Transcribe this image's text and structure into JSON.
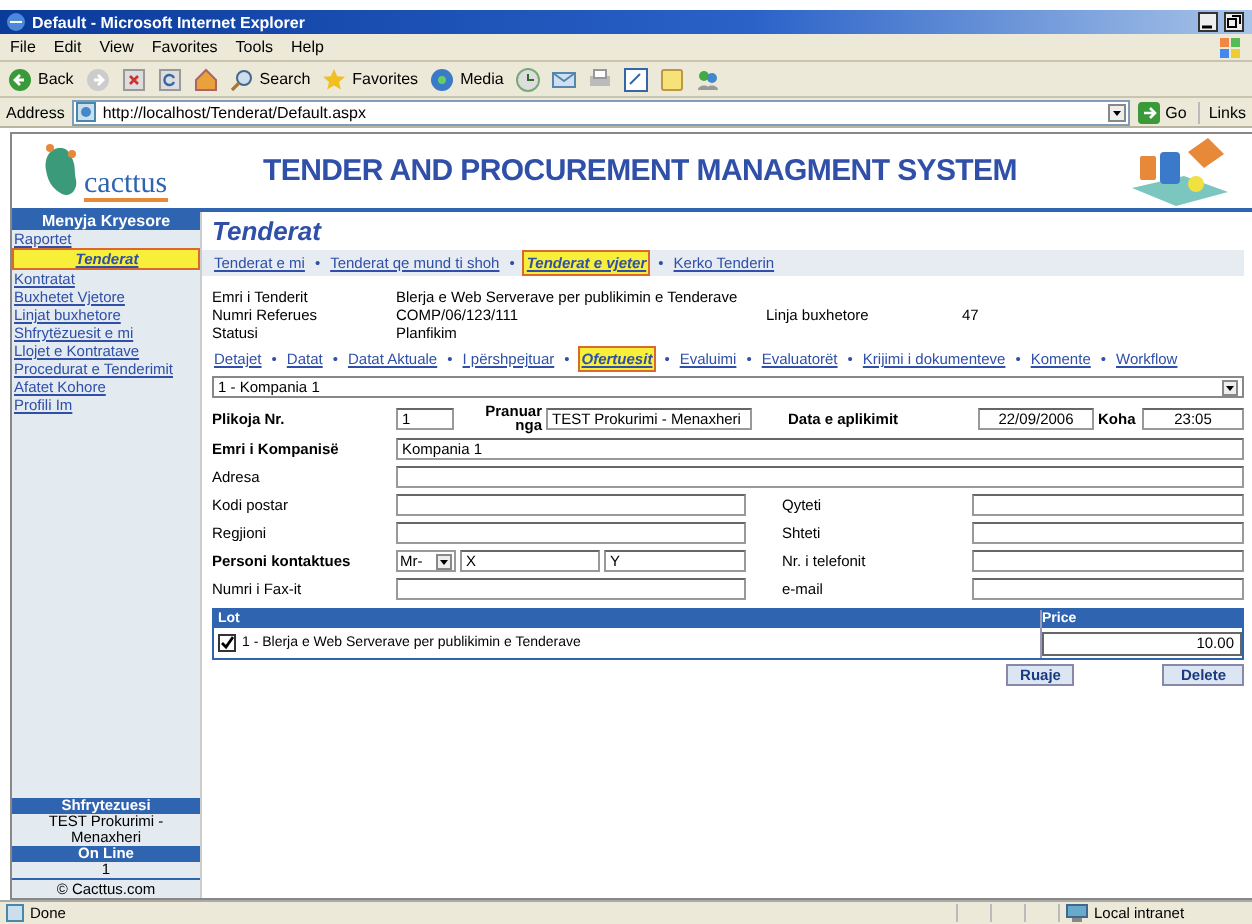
{
  "window": {
    "title": "Default - Microsoft Internet Explorer"
  },
  "menu": [
    "File",
    "Edit",
    "View",
    "Favorites",
    "Tools",
    "Help"
  ],
  "toolbar": [
    {
      "kind": "back",
      "label": "Back"
    },
    {
      "kind": "forward"
    },
    {
      "kind": "stop"
    },
    {
      "kind": "refresh"
    },
    {
      "kind": "home"
    },
    {
      "kind": "search",
      "label": "Search"
    },
    {
      "kind": "favorites",
      "label": "Favorites"
    },
    {
      "kind": "media",
      "label": "Media"
    },
    {
      "kind": "history"
    },
    {
      "kind": "mail"
    },
    {
      "kind": "print"
    },
    {
      "kind": "edit"
    },
    {
      "kind": "note"
    },
    {
      "kind": "messenger"
    }
  ],
  "address": {
    "label": "Address",
    "url": "http://localhost/Tenderat/Default.aspx",
    "go": "Go",
    "links": "Links"
  },
  "header": {
    "logo": "cacttus",
    "title": "TENDER AND PROCUREMENT MANAGMENT SYSTEM"
  },
  "sidebar": {
    "title": "Menyja Kryesore",
    "items": [
      {
        "label": "Raportet",
        "selected": false
      },
      {
        "label": "Tenderat",
        "selected": true
      },
      {
        "label": "Kontratat",
        "selected": false
      },
      {
        "label": "Buxhetet Vjetore",
        "selected": false
      },
      {
        "label": "Linjat buxhetore",
        "selected": false
      },
      {
        "label": "Shfrytëzuesit e mi",
        "selected": false
      },
      {
        "label": "Llojet e Kontratave",
        "selected": false
      },
      {
        "label": "Procedurat e Tenderimit",
        "selected": false
      },
      {
        "label": "Afatet Kohore",
        "selected": false
      },
      {
        "label": "Profili Im",
        "selected": false
      }
    ],
    "user_label": "Shfrytezuesi",
    "user_name": "TEST Prokurimi - Menaxheri",
    "online_label": "On Line",
    "online_count": "1",
    "copyright": "© Cacttus.com"
  },
  "main": {
    "title": "Tenderat",
    "separator": "•",
    "tabs": [
      {
        "label": "Tenderat e mi",
        "selected": false
      },
      {
        "label": "Tenderat qe mund ti shoh",
        "selected": false
      },
      {
        "label": "Tenderat e vjeter",
        "selected": true
      },
      {
        "label": "Kerko Tenderin",
        "selected": false
      }
    ],
    "info": [
      {
        "label": "Emri i Tenderit",
        "value": "Blerja e Web Serverave per publikimin e Tenderave"
      },
      {
        "label": "Numri Referues",
        "value": "COMP/06/123/111",
        "label_2": "Linja buxhetore",
        "value_2": "47"
      },
      {
        "label": "Statusi",
        "value": "Planfikim"
      }
    ],
    "subtabs": [
      {
        "label": "Detajet",
        "selected": false
      },
      {
        "label": "Datat",
        "selected": false
      },
      {
        "label": "Datat Aktuale",
        "selected": false
      },
      {
        "label": "I përshpejtuar",
        "selected": false
      },
      {
        "label": "Ofertuesit",
        "selected": true
      },
      {
        "label": "Evaluimi",
        "selected": false
      },
      {
        "label": "Evaluatorët",
        "selected": false
      },
      {
        "label": "Krijimi i dokumenteve",
        "selected": false
      },
      {
        "label": "Komente",
        "selected": false
      },
      {
        "label": "Workflow",
        "selected": false
      }
    ],
    "company_select": "1 - Kompania 1",
    "rows": [
      {
        "kind": "first",
        "cells": [
          {
            "kind": "label",
            "text": "Plikoja Nr.",
            "bold": true
          },
          {
            "kind": "input",
            "value": "1"
          },
          {
            "kind": "label",
            "text": "Pranuar nga",
            "bold": true
          },
          {
            "kind": "input",
            "value": "TEST Prokurimi - Menaxheri"
          },
          {
            "kind": "label",
            "text": "Data e aplikimit",
            "bold": true
          },
          {
            "kind": "input",
            "value": "22/09/2006"
          },
          {
            "kind": "label",
            "text": "Koha",
            "bold": true
          },
          {
            "kind": "input",
            "value": "23:05"
          }
        ]
      },
      {
        "kind": "single",
        "cells": [
          {
            "kind": "label",
            "text": "Emri i Kompanisë",
            "bold": true
          },
          {
            "kind": "input",
            "value": "Kompania 1"
          }
        ]
      },
      {
        "kind": "single",
        "cells": [
          {
            "kind": "label",
            "text": "Adresa",
            "bold": false
          },
          {
            "kind": "input"
          }
        ]
      },
      {
        "kind": "pair",
        "cells": [
          {
            "kind": "label",
            "text": "Kodi postar",
            "bold": false
          },
          {
            "kind": "input"
          },
          {
            "kind": "label",
            "text": "Qyteti",
            "bold": false
          },
          {
            "kind": "input"
          }
        ]
      },
      {
        "kind": "pair",
        "cells": [
          {
            "kind": "label",
            "text": "Regjioni",
            "bold": false
          },
          {
            "kind": "input"
          },
          {
            "kind": "label",
            "text": "Shteti",
            "bold": false
          },
          {
            "kind": "input"
          }
        ]
      },
      {
        "kind": "contact",
        "cells": [
          {
            "kind": "label",
            "text": "Personi kontaktues",
            "bold": true
          },
          {
            "kind": "select",
            "value": "Mr-"
          },
          {
            "kind": "input",
            "value": "X"
          },
          {
            "kind": "input",
            "value": "Y"
          },
          {
            "kind": "label",
            "text": "Nr. i telefonit",
            "bold": false
          },
          {
            "kind": "input"
          }
        ]
      },
      {
        "kind": "pair",
        "cells": [
          {
            "kind": "label",
            "text": "Numri i Fax-it",
            "bold": false
          },
          {
            "kind": "input"
          },
          {
            "kind": "label",
            "text": "e-mail",
            "bold": false
          },
          {
            "kind": "input"
          }
        ]
      }
    ],
    "lots": {
      "columns": [
        "Lot",
        "Price"
      ],
      "rows": [
        {
          "checked": true,
          "label": "1 - Blerja e Web Serverave per publikimin e Tenderave",
          "price": "10.00"
        }
      ]
    },
    "buttons": [
      "Ruaje",
      "Delete"
    ]
  },
  "status_bar": {
    "text": "Done",
    "zone": "Local intranet"
  }
}
